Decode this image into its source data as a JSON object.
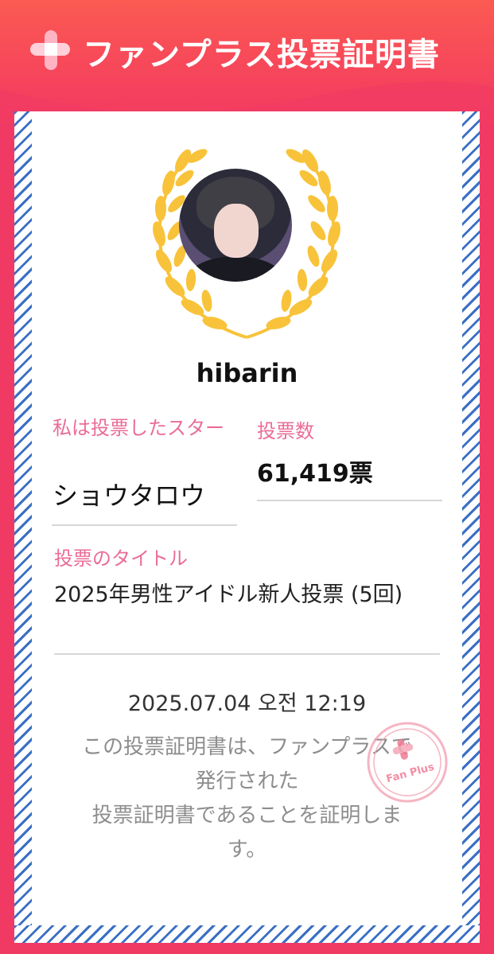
{
  "header": {
    "title": "ファンプラス投票証明書",
    "logo_icon": "fanplus-cross-logo-icon"
  },
  "certificate": {
    "username": "hibarin",
    "star_label": "私は投票したスター",
    "star_name": "ショウタロウ",
    "votes_label": "投票数",
    "votes_value": "61,419票",
    "title_label": "投票のタイトル",
    "title_value": "2025年男性アイドル新人投票 (5回)",
    "date": "2025.07.04 오전 12:19",
    "cert_line1": "この投票証明書は、ファンプラスで",
    "cert_line2": "発行された",
    "cert_line3": "投票証明書であることを証明しま",
    "cert_line4": "す。",
    "stamp_text": "Fan Plus"
  },
  "colors": {
    "header_top": "#fb5a52",
    "header_bottom": "#f03a64",
    "label_pink": "#ea6c98",
    "laurel_gold": "#f8c33a",
    "stripe_blue": "#3a6fc4"
  }
}
